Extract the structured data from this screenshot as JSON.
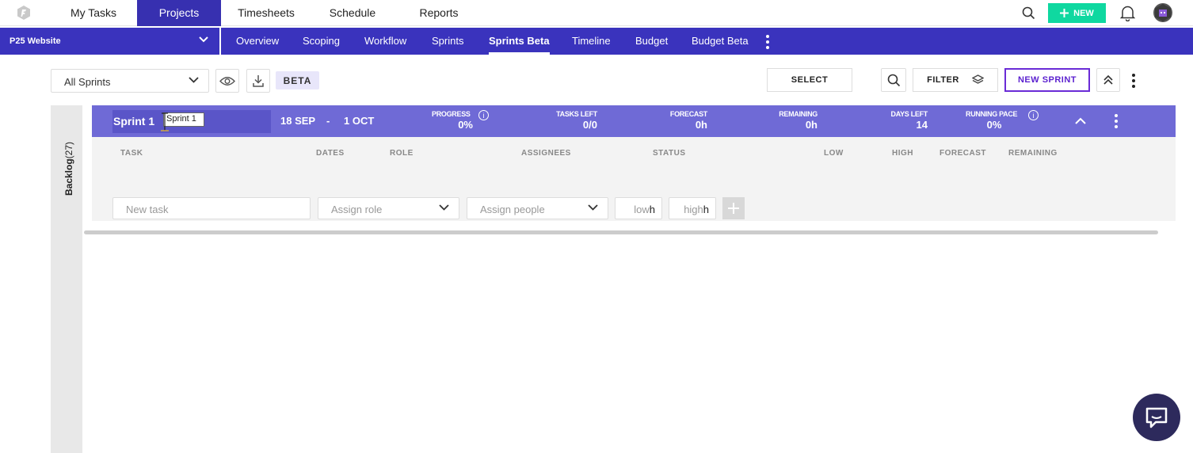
{
  "topnav": {
    "items": [
      {
        "label": "My Tasks"
      },
      {
        "label": "Projects",
        "active": true
      },
      {
        "label": "Timesheets"
      },
      {
        "label": "Schedule"
      },
      {
        "label": "Reports"
      }
    ],
    "new_label": "NEW",
    "accent_color": "#3730b0",
    "new_color": "#0fd8a0"
  },
  "project": {
    "name": "P25 Website"
  },
  "subnav": {
    "items": [
      {
        "label": "Overview"
      },
      {
        "label": "Scoping"
      },
      {
        "label": "Workflow"
      },
      {
        "label": "Sprints"
      },
      {
        "label": "Sprints Beta",
        "active": true
      },
      {
        "label": "Timeline"
      },
      {
        "label": "Budget"
      },
      {
        "label": "Budget Beta"
      }
    ]
  },
  "toolbar": {
    "sprint_filter": "All Sprints",
    "beta_badge": "BETA",
    "select_label": "SELECT",
    "filter_label": "FILTER",
    "new_sprint_label": "NEW SPRINT"
  },
  "backlog": {
    "label": "Backlog",
    "count": "(27)"
  },
  "sprint": {
    "name": "Sprint 1",
    "tooltip": "Sprint 1",
    "start": "18 SEP",
    "separator": "-",
    "end": "1 OCT",
    "metrics": {
      "progress": {
        "label": "PROGRESS",
        "value": "0%"
      },
      "tasks_left": {
        "label": "TASKS LEFT",
        "value": "0/0"
      },
      "forecast": {
        "label": "FORECAST",
        "value": "0h"
      },
      "remaining": {
        "label": "REMAINING",
        "value": "0h"
      },
      "days_left": {
        "label": "DAYS LEFT",
        "value": "14"
      },
      "running_pace": {
        "label": "RUNNING PACE",
        "value": "0%"
      }
    },
    "header_color": "#6f6ad6"
  },
  "table": {
    "columns": {
      "task": "TASK",
      "dates": "DATES",
      "role": "ROLE",
      "assignees": "ASSIGNEES",
      "status": "STATUS",
      "low": "LOW",
      "high": "HIGH",
      "forecast": "FORECAST",
      "remaining": "REMAINING"
    },
    "new_task_placeholder": "New task",
    "role_placeholder": "Assign role",
    "people_placeholder": "Assign people",
    "low_placeholder": "low",
    "high_placeholder": "high",
    "unit": "h"
  }
}
